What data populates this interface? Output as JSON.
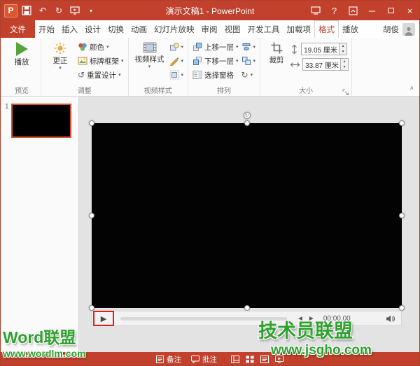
{
  "window": {
    "title": "演示文稿1 - PowerPoint",
    "user": "胡俊"
  },
  "icons": {
    "app_letter": "P",
    "dropdown": "▾",
    "spinner_up": "▲",
    "spinner_down": "▼",
    "undo": "↶",
    "redo": "↻",
    "help": "?",
    "minimize": "─",
    "close": "×",
    "play_small": "▶",
    "media_back": "◄",
    "media_forward": "►",
    "rotate": "↻",
    "reset": "↺",
    "collapse_ribbon": "˄",
    "rotation_handle": "↻"
  },
  "tabs": {
    "file": "文件",
    "items": [
      "开始",
      "插入",
      "设计",
      "切换",
      "动画",
      "幻灯片放映",
      "审阅",
      "视图",
      "开发工具",
      "加载项"
    ],
    "format": "格式",
    "playback": "播放"
  },
  "ribbon": {
    "preview": {
      "label": "预览",
      "play": "播放"
    },
    "adjust": {
      "label": "调整",
      "corrections": "更正",
      "color": "颜色",
      "poster_frame": "标牌框架",
      "reset_design": "重置设计"
    },
    "video_styles": {
      "label": "视频样式",
      "gallery": "视频样式"
    },
    "arrange": {
      "label": "排列",
      "bring_forward": "上移一层",
      "send_backward": "下移一层",
      "selection_pane": "选择窗格"
    },
    "size": {
      "label": "大小",
      "crop": "裁剪",
      "height_value": "19.05 厘米",
      "width_value": "33.87 厘米"
    }
  },
  "slides": {
    "number": "1"
  },
  "media": {
    "time": "00:00.00"
  },
  "statusbar": {
    "notes": "备注",
    "comments": "批注"
  },
  "watermarks": {
    "left_name": "Word联盟",
    "left_url": "www.wordlm.com",
    "right_name": "技术员联盟",
    "right_url": "www.jsgho.com"
  },
  "colors": {
    "accent_red": "#C2412D",
    "selection_orange": "#D35230",
    "annotation_red": "#DF2218",
    "watermark_green": "#2EA12E",
    "play_green": "#59A33E"
  }
}
